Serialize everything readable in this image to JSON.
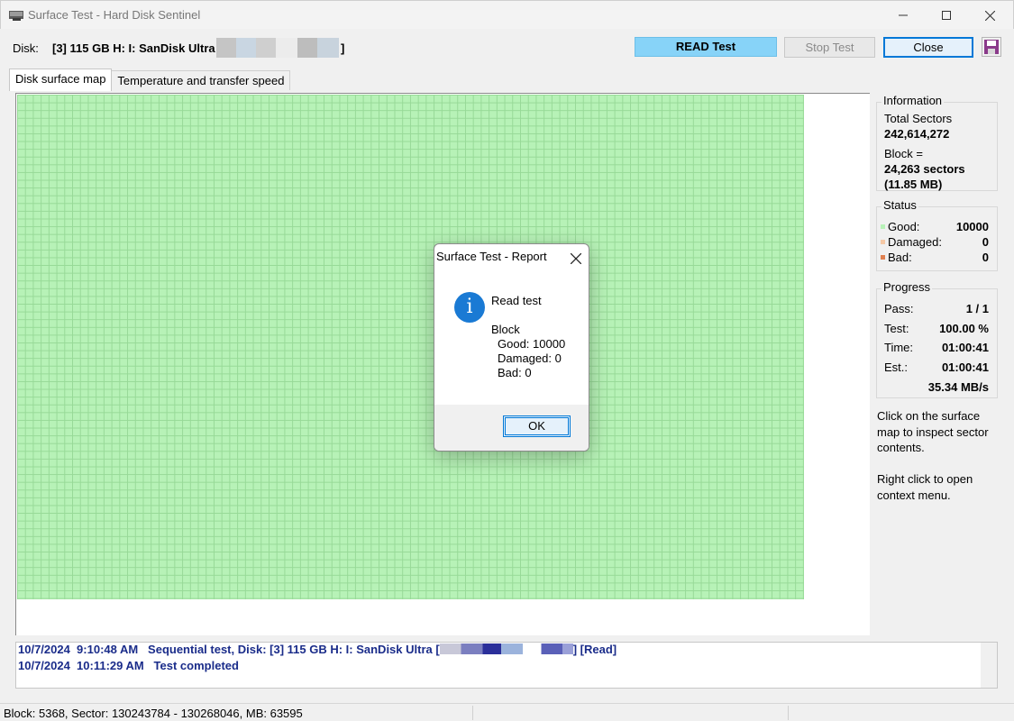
{
  "window": {
    "title": "Surface Test - Hard Disk Sentinel",
    "minimize_icon": "minimize-icon",
    "maximize_icon": "maximize-icon",
    "close_icon": "close-icon"
  },
  "header": {
    "disk_label": "Disk:",
    "disk_value": "[3] 115 GB H: I: SanDisk Ultra [",
    "disk_close_bracket": "]",
    "read_test_label": "READ Test",
    "stop_test_label": "Stop Test",
    "close_label": "Close",
    "save_icon": "save-icon",
    "colors": {
      "read_test": "#87d3f8"
    }
  },
  "tabs": [
    {
      "label": "Disk surface map",
      "active": true
    },
    {
      "label": "Temperature and transfer speed",
      "active": false
    }
  ],
  "map": {
    "color_good": "#b7f2b7",
    "grid_color": "#97d997",
    "good_fraction": 1.0
  },
  "information": {
    "title": "Information",
    "total_sectors_label": "Total Sectors",
    "total_sectors_value": "242,614,272",
    "block_label": "Block =",
    "block_sectors": "24,263 sectors",
    "block_mb": "(11.85 MB)"
  },
  "status": {
    "title": "Status",
    "good_label": "Good:",
    "good_value": "10000",
    "damaged_label": "Damaged:",
    "damaged_value": "0",
    "bad_label": "Bad:",
    "bad_value": "0",
    "colors": {
      "good": "#b7f2b7",
      "damaged": "#f6c9a6",
      "bad": "#e08050"
    }
  },
  "progress": {
    "title": "Progress",
    "pass_label": "Pass:",
    "pass_value": "1 / 1",
    "test_label": "Test:",
    "test_value": "100.00 %",
    "time_label": "Time:",
    "time_value": "01:00:41",
    "est_label": "Est.:",
    "est_value": "01:00:41",
    "speed_value": "35.34 MB/s"
  },
  "hints": {
    "hint1": "Click on the surface map to inspect sector contents.",
    "hint2": "Right click to open context menu."
  },
  "log": {
    "line1_prefix": "10/7/2024  9:10:48 AM   Sequential test, Disk: [3] 115 GB H: I: SanDisk Ultra [",
    "line1_suffix": "] [Read]",
    "line2": "10/7/2024  10:11:29 AM   Test completed"
  },
  "statusbar": {
    "text": "Block: 5368, Sector: 130243784 - 130268046, MB: 63595"
  },
  "dialog": {
    "title": "Surface Test - Report",
    "close_icon": "close-icon",
    "info_icon": "info-icon",
    "heading": "Read test",
    "block_label": "Block",
    "good_line": "Good: 10000",
    "damaged_line": "Damaged: 0",
    "bad_line": "Bad: 0",
    "ok_label": "OK"
  }
}
